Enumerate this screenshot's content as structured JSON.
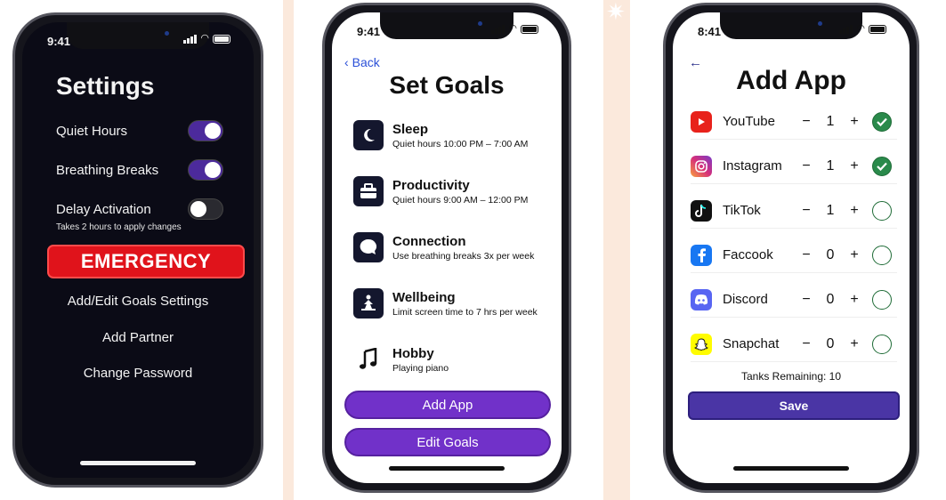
{
  "colors": {
    "accent_purple": "#7131c9",
    "toggle_on": "#4c2a9c",
    "emergency_red": "#e0131b",
    "save_blue": "#4a35a5",
    "check_green": "#2a8a4b",
    "back_link": "#2b50d8"
  },
  "settings_screen": {
    "status_time": "9:41",
    "title": "Settings",
    "toggles": [
      {
        "label": "Quiet Hours",
        "on": true
      },
      {
        "label": "Breathing Breaks",
        "on": true
      },
      {
        "label": "Delay Activation",
        "on": false
      }
    ],
    "delay_hint": "Takes 2 hours to apply changes",
    "emergency_label": "EMERGENCY",
    "links": [
      "Add/Edit Goals Settings",
      "Add Partner",
      "Change Password"
    ]
  },
  "goals_screen": {
    "status_time": "9:41",
    "back_label": "Back",
    "title": "Set Goals",
    "goals": [
      {
        "title": "Sleep",
        "subtitle": "Quiet hours 10:00 PM – 7:00 AM",
        "icon": "moon-icon"
      },
      {
        "title": "Productivity",
        "subtitle": "Quiet hours 9:00 AM – 12:00 PM",
        "icon": "briefcase-icon"
      },
      {
        "title": "Connection",
        "subtitle": "Use breathing breaks 3x per week",
        "icon": "chat-bubble-icon"
      },
      {
        "title": "Wellbeing",
        "subtitle": "Limit screen time to 7 hrs per week",
        "icon": "meditation-icon"
      },
      {
        "title": "Hobby",
        "subtitle": "Playing piano",
        "icon": "music-note-icon"
      }
    ],
    "add_app_label": "Add App",
    "edit_goals_label": "Edit Goals"
  },
  "add_app_screen": {
    "status_time": "8:41",
    "back_arrow": "←",
    "title": "Add App",
    "apps": [
      {
        "name": "YouTube",
        "count": "1",
        "selected": true,
        "icon": "youtube-icon",
        "color": "#e8221b"
      },
      {
        "name": "Instagram",
        "count": "1",
        "selected": true,
        "icon": "instagram-icon",
        "color": "#d62f7a"
      },
      {
        "name": "TikTok",
        "count": "1",
        "selected": false,
        "icon": "tiktok-icon",
        "color": "#111111"
      },
      {
        "name": "Faccook",
        "count": "0",
        "selected": false,
        "icon": "facebook-icon",
        "color": "#1877f2"
      },
      {
        "name": "Discord",
        "count": "0",
        "selected": false,
        "icon": "discord-icon",
        "color": "#5865f2"
      },
      {
        "name": "Snapchat",
        "count": "0",
        "selected": false,
        "icon": "snapchat-icon",
        "color": "#fffc00"
      }
    ],
    "minus_glyph": "−",
    "plus_glyph": "+",
    "tanks_remaining": "Tanks Remaining: 10",
    "save_label": "Save"
  }
}
